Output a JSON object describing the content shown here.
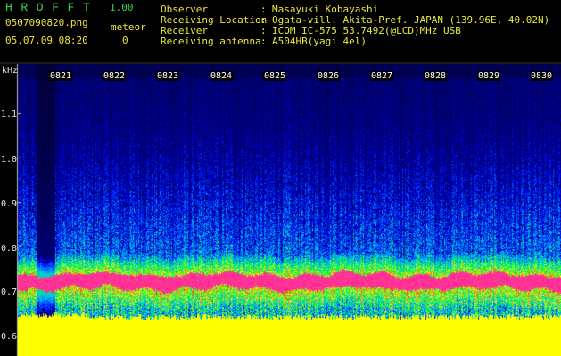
{
  "header": {
    "app_name": "HROFFT",
    "version": "1.00",
    "file_name": "0507090820.png",
    "date_time": "05.07.09 08:20",
    "meteor_label": "meteor",
    "meteor_count": "0"
  },
  "info": [
    {
      "label": "Observer",
      "value": "Masayuki Kobayashi"
    },
    {
      "label": "Receiving Location",
      "value": "Ogata-vill. Akita-Pref. JAPAN (139.96E, 40.02N)"
    },
    {
      "label": "Receiver",
      "value": "ICOM IC-575 53.7492(@LCD)MHz USB"
    },
    {
      "label": "Receiving antenna",
      "value": "A504HB(yagi 4el)"
    }
  ],
  "spectrogram": {
    "unit": "kHz",
    "y_ticks": [
      "1.1",
      "1.0",
      "0.9",
      "0.8",
      "0.7",
      "0.6"
    ],
    "x_ticks": [
      "0821",
      "0822",
      "0823",
      "0824",
      "0825",
      "0826",
      "0827",
      "0828",
      "0829",
      "0830"
    ],
    "colors": {
      "signal": "#ff2a8a",
      "noise": "#ffff00",
      "background": "#000000"
    }
  }
}
